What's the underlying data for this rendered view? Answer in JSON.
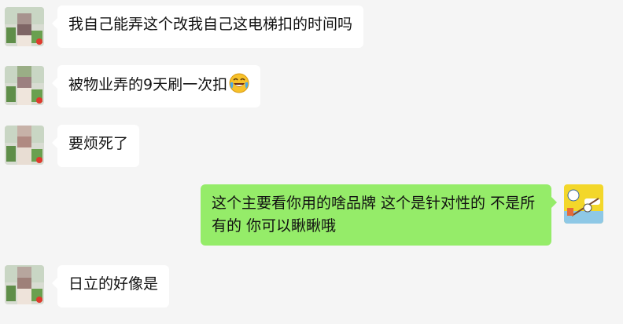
{
  "messages": [
    {
      "side": "in",
      "text": "我自己能弄这个改我自己这电梯扣的时间吗"
    },
    {
      "side": "in",
      "text": "被物业弄的9天刷一次扣",
      "emoji": "rolling-on-floor-laughing-emoji"
    },
    {
      "side": "in",
      "text": "要烦死了"
    },
    {
      "side": "out",
      "text": "这个主要看你用的啥品牌 这个是针对性的  不是所有的  你可以瞅瞅哦"
    },
    {
      "side": "in",
      "text": "日立的好像是"
    }
  ],
  "colors": {
    "background": "#f5f5f5",
    "incoming_bubble": "#ffffff",
    "outgoing_bubble": "#95ec69",
    "text": "#111111"
  }
}
